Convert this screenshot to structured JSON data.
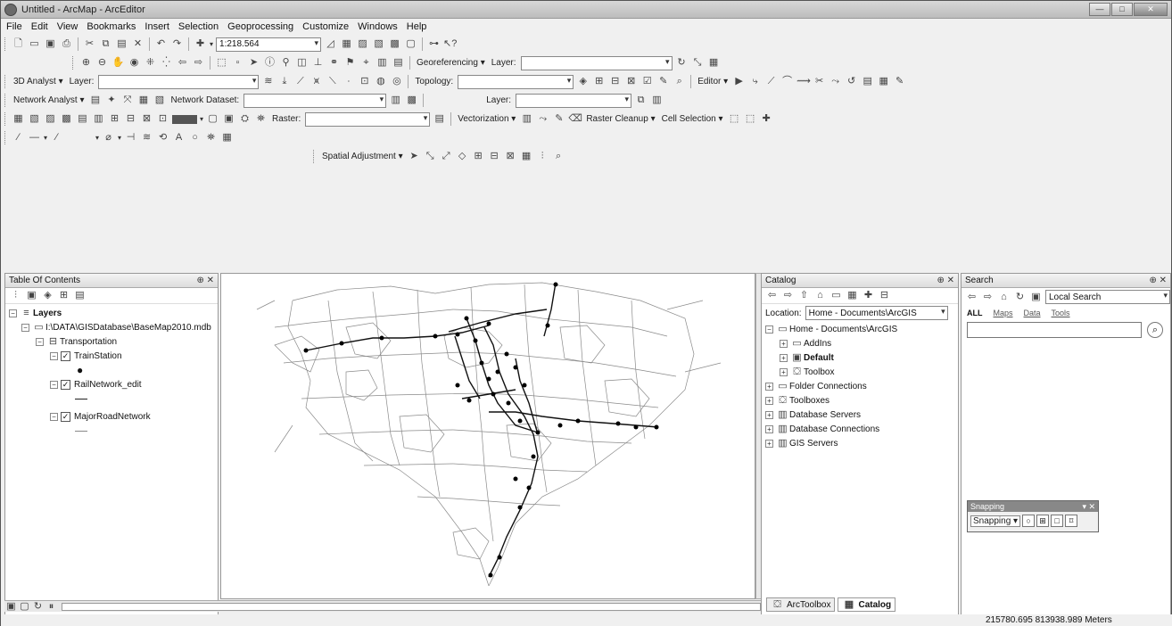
{
  "window": {
    "title": "Untitled - ArcMap - ArcEditor",
    "min": "—",
    "max": "□",
    "close": "✕"
  },
  "menu": [
    "File",
    "Edit",
    "View",
    "Bookmarks",
    "Insert",
    "Selection",
    "Geoprocessing",
    "Customize",
    "Windows",
    "Help"
  ],
  "toolbars": {
    "scale": "1:218.564",
    "georef": "Georeferencing ▾",
    "layer": "Layer:",
    "analyst": "3D Analyst ▾",
    "layer2": "Layer:",
    "topology": "Topology:",
    "editor": "Editor ▾",
    "network_analyst": "Network Analyst ▾",
    "network_dataset": "Network Dataset:",
    "layer3": "Layer:",
    "raster": "Raster:",
    "vectorization": "Vectorization ▾",
    "raster_cleanup": "Raster Cleanup ▾",
    "cell_selection": "Cell Selection ▾",
    "spatial_adjustment": "Spatial Adjustment ▾"
  },
  "toc": {
    "title": "Table Of Contents",
    "pin": "⊕ ✕",
    "layers": "Layers",
    "db": "I:\\DATA\\GISDatabase\\BaseMap2010.mdb",
    "group": "Transportation",
    "l1": "TrainStation",
    "l2": "RailNetwork_edit",
    "l3": "MajorRoadNetwork"
  },
  "catalog": {
    "title": "Catalog",
    "pin": "⊕ ✕",
    "location_label": "Location:",
    "location": "Home - Documents\\ArcGIS",
    "items": {
      "home": "Home - Documents\\ArcGIS",
      "addins": "AddIns",
      "default": "Default",
      "toolbox": "Toolbox",
      "folder": "Folder Connections",
      "toolboxes": "Toolboxes",
      "dbservers": "Database Servers",
      "dbconn": "Database Connections",
      "gis": "GIS Servers"
    },
    "tab1": "ArcToolbox",
    "tab2": "Catalog"
  },
  "search": {
    "title": "Search",
    "pin": "⊕ ✕",
    "local": "Local Search",
    "all": "ALL",
    "maps": "Maps",
    "data": "Data",
    "tools": "Tools"
  },
  "snapping": {
    "title": "Snapping",
    "label": "Snapping ▾"
  },
  "status": {
    "coords": "215780.695  813938.989 Meters"
  },
  "colors": {
    "rail": "#111111",
    "road": "#8a8a8a",
    "station": "#000000"
  }
}
